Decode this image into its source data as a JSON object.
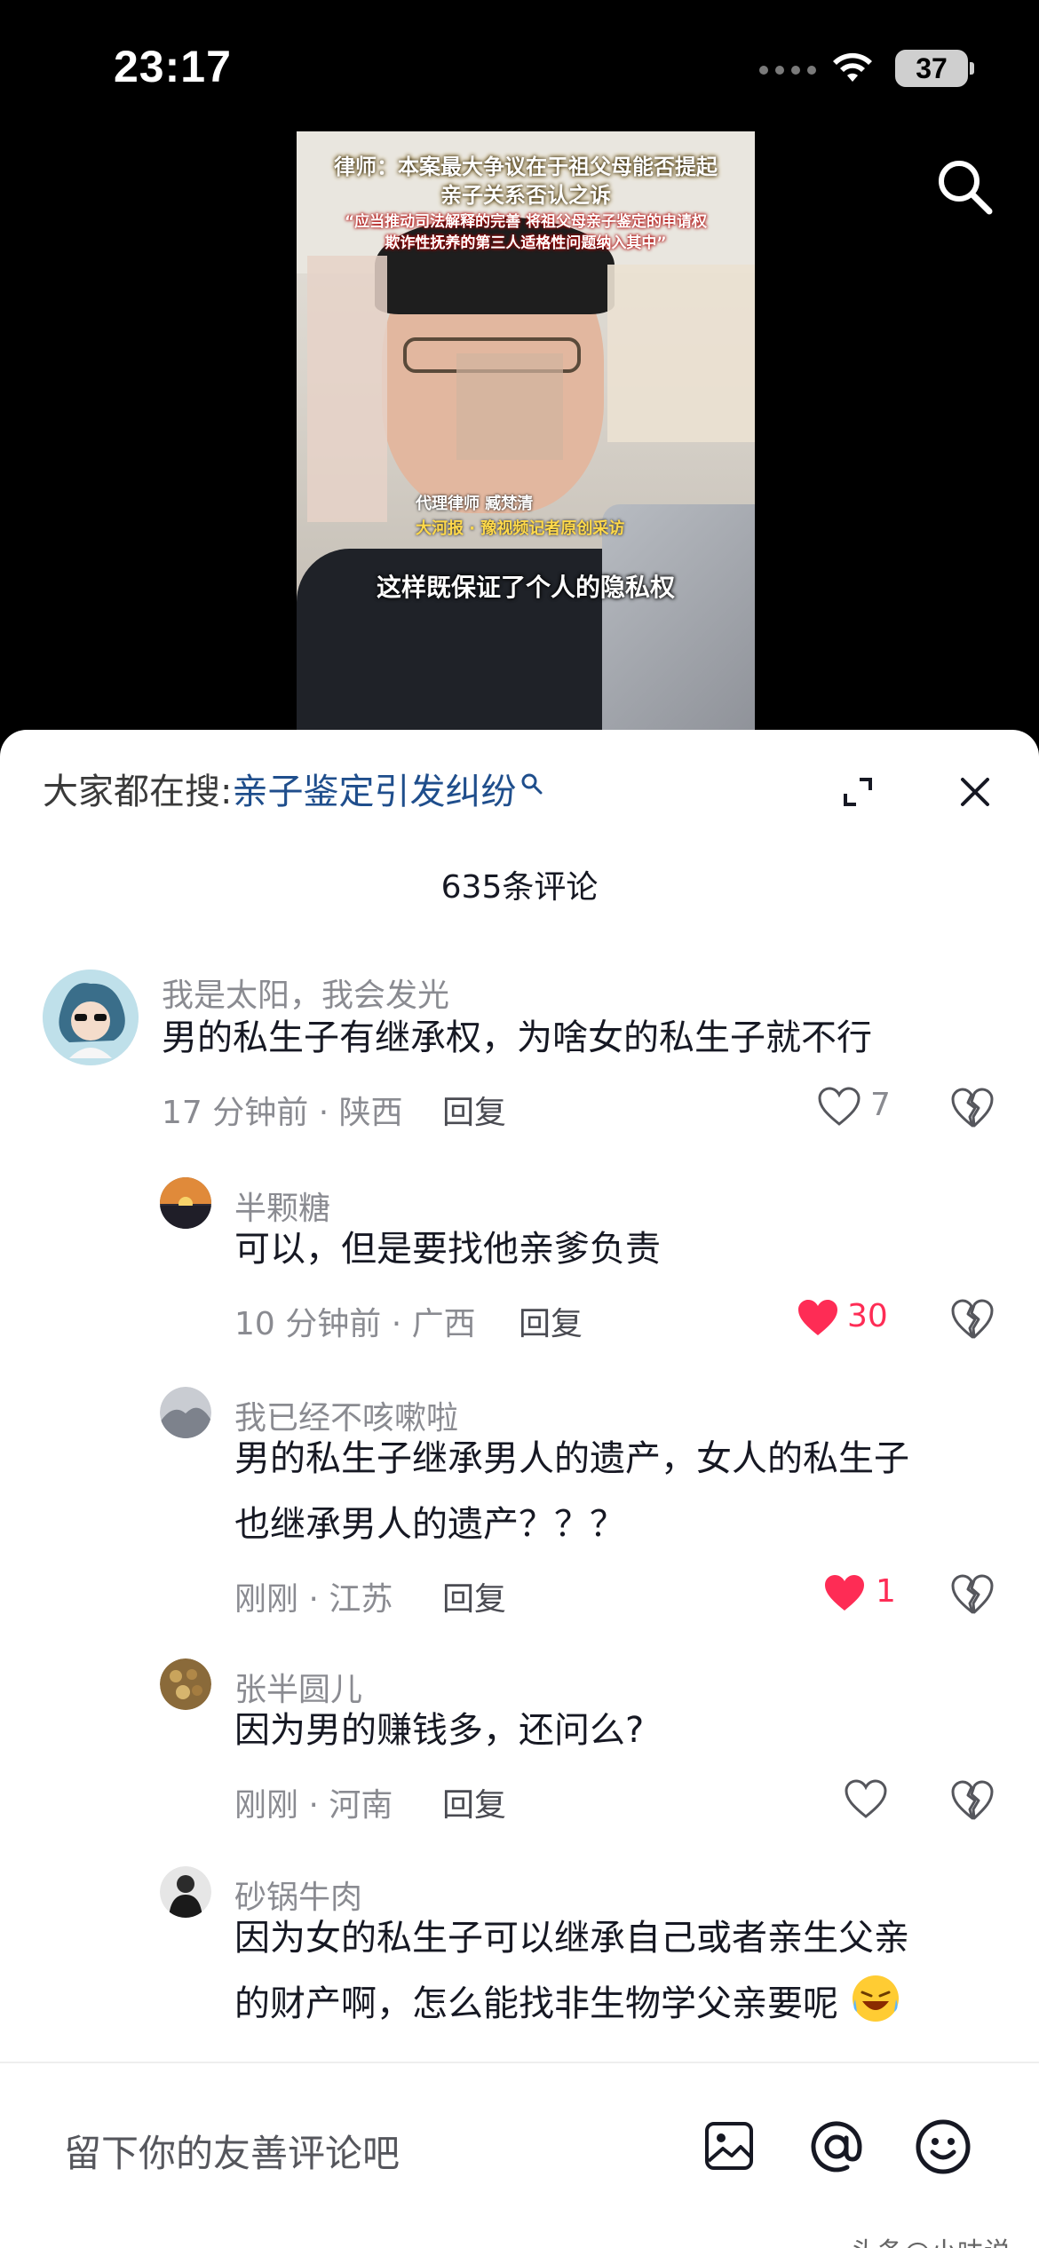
{
  "status_bar": {
    "time": "23:17",
    "battery": "37"
  },
  "video": {
    "title_line1": "律师：本案最大争议在于祖父母能否提起",
    "title_line2": "亲子关系否认之诉",
    "subtitle_line1": "“应当推动司法解释的完善 将祖父母亲子鉴定的申请权",
    "subtitle_line2": "欺诈性抚养的第三人适格性问题纳入其中”",
    "tag_line1": "代理律师 臧梵清",
    "tag_line2": "大河报 · 豫视频记者原创采访",
    "caption": "这样既保证了个人的隐私权"
  },
  "sheet": {
    "search_prefix": "大家都在搜:",
    "search_term": "亲子鉴定引发纠纷",
    "comment_count": "635条评论"
  },
  "comments": [
    {
      "name": "我是太阳，我会发光",
      "text": "男的私生子有继承权，为啥女的私生子就不行",
      "meta": "17 分钟前 · 陕西",
      "reply": "回复",
      "likes": "7",
      "liked": false
    },
    {
      "name": "半颗糖",
      "text": "可以，但是要找他亲爹负责",
      "meta": "10 分钟前 · 广西",
      "reply": "回复",
      "likes": "30",
      "liked": true
    },
    {
      "name": "我已经不咳嗽啦",
      "text_line1": "男的私生子继承男人的遗产，女人的私生子",
      "text_line2": "也继承男人的遗产？？？",
      "meta": "刚刚 · 江苏",
      "reply": "回复",
      "likes": "1",
      "liked": true
    },
    {
      "name": "张半圆儿",
      "text": "因为男的赚钱多，还问么?",
      "meta": "刚刚 · 河南",
      "reply": "回复",
      "likes": "",
      "liked": false
    },
    {
      "name": "砂锅牛肉",
      "text_line1": "因为女的私生子可以继承自己或者亲生父亲",
      "text_line2": "的财产啊，怎么能找非生物学父亲要呢"
    }
  ],
  "input_bar": {
    "placeholder": "留下你的友善评论吧"
  },
  "watermark": "头条@小呋说",
  "colors": {
    "accent_like": "#fe2c55",
    "search_term": "#1f4e8c",
    "secondary_text": "#8a8b91"
  },
  "icons": [
    "search-icon",
    "expand-icon",
    "close-icon",
    "heart-icon",
    "broken-heart-icon",
    "image-icon",
    "at-icon",
    "emoji-icon",
    "wifi-icon",
    "battery-icon"
  ]
}
